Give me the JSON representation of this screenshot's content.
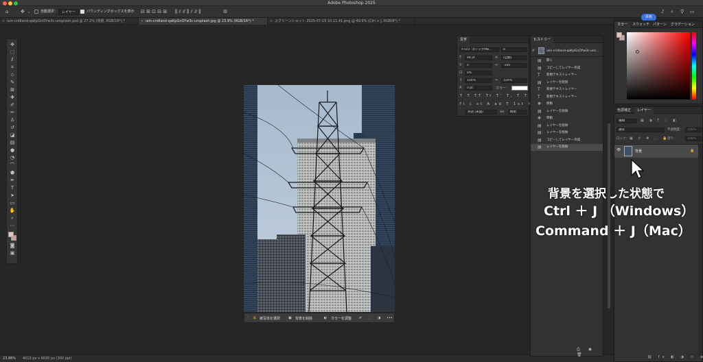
{
  "window": {
    "title": "Adobe Photoshop 2025"
  },
  "options_bar": {
    "auto_select_label": "自動選択：",
    "auto_select_target": "レイヤー",
    "bounding_box_label": "バウンディングボックスを表示",
    "share_label": "共有"
  },
  "tabs": [
    {
      "label": "iain-cridland-qaKpGnOYw3c-unsplash.psd @ 27.2% (背景, RGB/16*) *",
      "active": false
    },
    {
      "label": "iain-cridland-qaKpGnOYw3c-unsplash.jpg @ 23.9% (RGB/16*) *",
      "active": true
    },
    {
      "label": "スクリーンショット 2025-07-15 10.11.41.png @ 49.6% (Ctrl + J, RGB/8*) *",
      "active": false
    }
  ],
  "context_bar": {
    "select_subject": "被写体を選択",
    "remove_background": "背景を削除",
    "adjust_color": "カラーを調整"
  },
  "status_bar": {
    "zoom": "23.88%",
    "doc_info": "4013 px x 6020 px (300 ppi)"
  },
  "character_panel": {
    "tab": "文字",
    "font_family": "A-OTF ゴシックMB...",
    "font_style": "H",
    "font_size": "48 pt",
    "leading": "(自動)",
    "kerning": "0",
    "tracking": "-100",
    "tsume": "0%",
    "vertical_scale": "100%",
    "horizontal_scale": "100%",
    "baseline_shift": "0 pt",
    "color_label": "カラー：",
    "language": "英語 (米国)",
    "aa_label": "aa",
    "aa_method": "鮮明"
  },
  "history_panel": {
    "tab": "ヒストリー",
    "snapshot": "iain-cridland-qaKpGnOYw3c-uns...",
    "items": [
      {
        "icon": "doc",
        "label": "開く"
      },
      {
        "icon": "doc",
        "label": "コピーしてレイヤー作成"
      },
      {
        "icon": "type",
        "label": "新規テキストレイヤー"
      },
      {
        "icon": "doc",
        "label": "レイヤーを削除"
      },
      {
        "icon": "type",
        "label": "新規テキストレイヤー"
      },
      {
        "icon": "type",
        "label": "新規テキストレイヤー"
      },
      {
        "icon": "move",
        "label": "移動"
      },
      {
        "icon": "doc",
        "label": "レイヤーを削除"
      },
      {
        "icon": "move",
        "label": "移動"
      },
      {
        "icon": "doc",
        "label": "レイヤーを削除"
      },
      {
        "icon": "doc",
        "label": "レイヤーを削除"
      },
      {
        "icon": "doc",
        "label": "コピーしてレイヤー作成"
      },
      {
        "icon": "doc",
        "label": "レイヤーを削除"
      }
    ]
  },
  "color_panel": {
    "tabs": [
      "カラー",
      "スウォッチ",
      "パターン",
      "グラデーション"
    ],
    "hue_color": "#ff0000"
  },
  "layers_panel": {
    "tabs": [
      "色調補正",
      "レイヤー"
    ],
    "search_placeholder": "種類",
    "blend_mode": "通常",
    "opacity_label": "不透明度：",
    "opacity": "100%",
    "lock_label": "ロック：",
    "fill_label": "塗り：",
    "fill": "100%",
    "layers": [
      {
        "name": "背景",
        "locked": true,
        "visible": true
      }
    ]
  },
  "overlay_text": {
    "line1": "背景を選択した状態で",
    "line2": "Ctrl ＋ J （Windows）",
    "line3": "Command ＋ J（Mac）"
  },
  "colors": {
    "fg_swatch": "#e3c4bb",
    "bg_swatch": "#c7a49b",
    "accent": "#3c6fe0"
  }
}
